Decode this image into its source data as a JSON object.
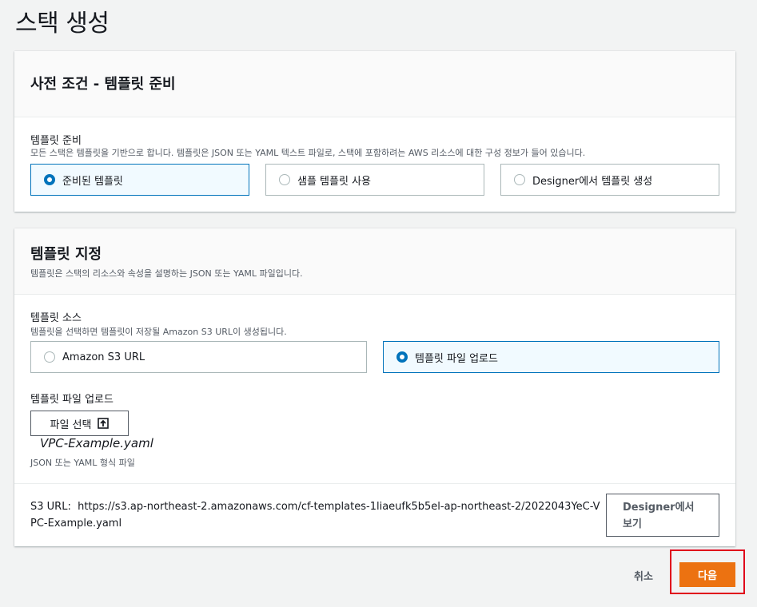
{
  "page": {
    "title": "스택 생성"
  },
  "prerequisite": {
    "title": "사전 조건 - 템플릿 준비",
    "label": "템플릿 준비",
    "description": "모든 스택은 템플릿을 기반으로 합니다. 템플릿은 JSON 또는 YAML 텍스트 파일로, 스택에 포함하려는 AWS 리소스에 대한 구성 정보가 들어 있습니다.",
    "options": [
      {
        "label": "준비된 템플릿",
        "selected": true
      },
      {
        "label": "샘플 템플릿 사용",
        "selected": false
      },
      {
        "label": "Designer에서 템플릿 생성",
        "selected": false
      }
    ]
  },
  "specify": {
    "title": "템플릿 지정",
    "description": "템플릿은 스택의 리소스와 속성을 설명하는 JSON 또는 YAML 파일입니다.",
    "source_label": "템플릿 소스",
    "source_description": "템플릿을 선택하면 템플릿이 저장될 Amazon S3 URL이 생성됩니다.",
    "source_options": [
      {
        "label": "Amazon S3 URL",
        "selected": false
      },
      {
        "label": "템플릿 파일 업로드",
        "selected": true
      }
    ],
    "upload_label": "템플릿 파일 업로드",
    "choose_file_label": "파일 선택",
    "file_name": "VPC-Example.yaml",
    "file_constraint": "JSON 또는 YAML 형식 파일",
    "s3_url_label": "S3 URL:",
    "s3_url_value": "https://s3.ap-northeast-2.amazonaws.com/cf-templates-1liaeufk5b5el-ap-northeast-2/2022043YeC-VPC-Example.yaml",
    "view_designer_label": "Designer에서 보기"
  },
  "footer": {
    "cancel_label": "취소",
    "next_label": "다음"
  },
  "colors": {
    "primary": "#ec7211",
    "selected": "#0073bb",
    "highlight": "#e0001b"
  }
}
